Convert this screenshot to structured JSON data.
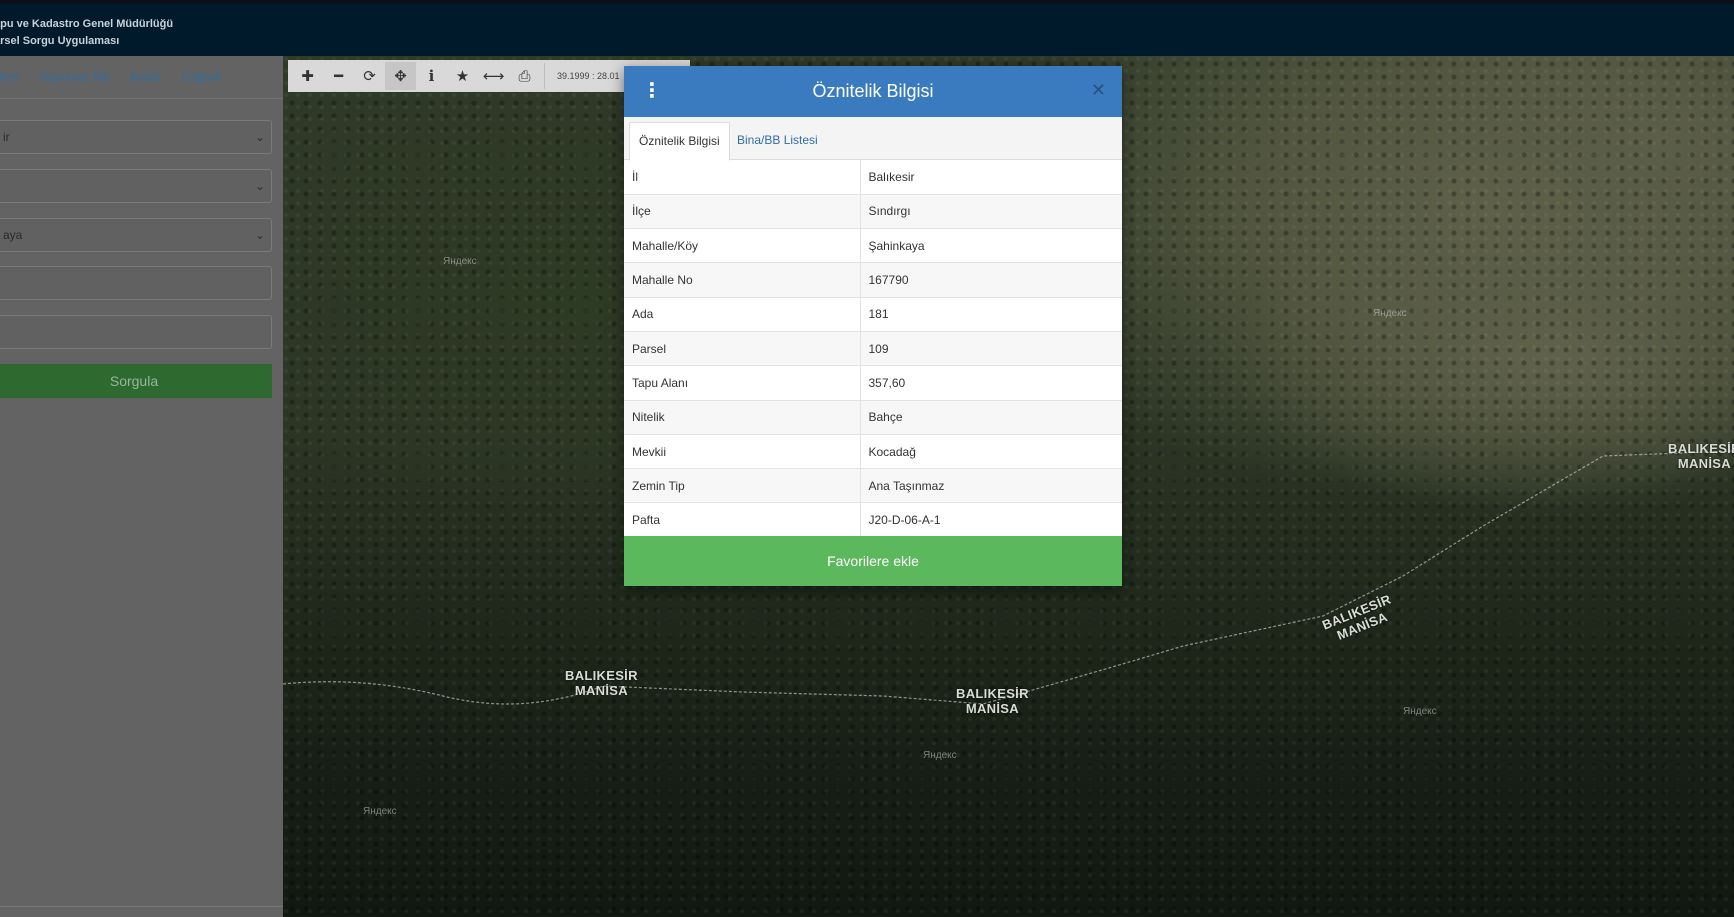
{
  "header": {
    "title_line1": "apu ve Kadastro Genel Müdürlüğü",
    "title_line2": "arsel Sorgu Uygulaması"
  },
  "sidebar": {
    "tabs": [
      {
        "label": "dres"
      },
      {
        "label": "Taşınmaz No"
      },
      {
        "label": "Analiz"
      },
      {
        "label": "Coğrafi"
      }
    ],
    "fields": [
      {
        "value": "ir",
        "type": "select"
      },
      {
        "value": "",
        "type": "select"
      },
      {
        "value": "aya",
        "type": "select"
      },
      {
        "value": "",
        "type": "input"
      },
      {
        "value": "",
        "type": "input"
      }
    ],
    "query_button": "Sorgula"
  },
  "map_toolbar": {
    "icons": [
      "zoom-in-icon",
      "zoom-out-icon",
      "refresh-icon",
      "pan-icon",
      "info-icon",
      "star-icon",
      "measure-icon",
      "print-icon"
    ],
    "coordinates": "39.1999 : 28.01"
  },
  "map": {
    "labels": [
      {
        "top": "BALIKESİR",
        "bottom": "MANİSA"
      },
      {
        "top": "BALIKESİR",
        "bottom": "MANİSA"
      },
      {
        "top": "BALIKESİR",
        "bottom": "MANİSA"
      },
      {
        "top": "BALIKESİR",
        "bottom": "MANİSA"
      }
    ],
    "watermark": "Яндекс"
  },
  "modal": {
    "title": "Öznitelik Bilgisi",
    "tabs": [
      {
        "label": "Öznitelik Bilgisi",
        "active": true
      },
      {
        "label": "Bina/BB Listesi",
        "active": false
      }
    ],
    "rows": [
      {
        "key": "İl",
        "value": "Balıkesir"
      },
      {
        "key": "İlçe",
        "value": "Sındırgı"
      },
      {
        "key": "Mahalle/Köy",
        "value": "Şahinkaya"
      },
      {
        "key": "Mahalle No",
        "value": "167790"
      },
      {
        "key": "Ada",
        "value": "181"
      },
      {
        "key": "Parsel",
        "value": "109"
      },
      {
        "key": "Tapu Alanı",
        "value": "357,60"
      },
      {
        "key": "Nitelik",
        "value": "Bahçe"
      },
      {
        "key": "Mevkii",
        "value": "Kocadağ"
      },
      {
        "key": "Zemin Tip",
        "value": "Ana Taşınmaz"
      },
      {
        "key": "Pafta",
        "value": "J20-D-06-A-1"
      }
    ],
    "favorite_button": "Favorilere ekle"
  },
  "colors": {
    "header_bg": "#001a2b",
    "modal_header": "#3a7bbf",
    "success": "#5cb85c",
    "link": "#2f6da3"
  }
}
